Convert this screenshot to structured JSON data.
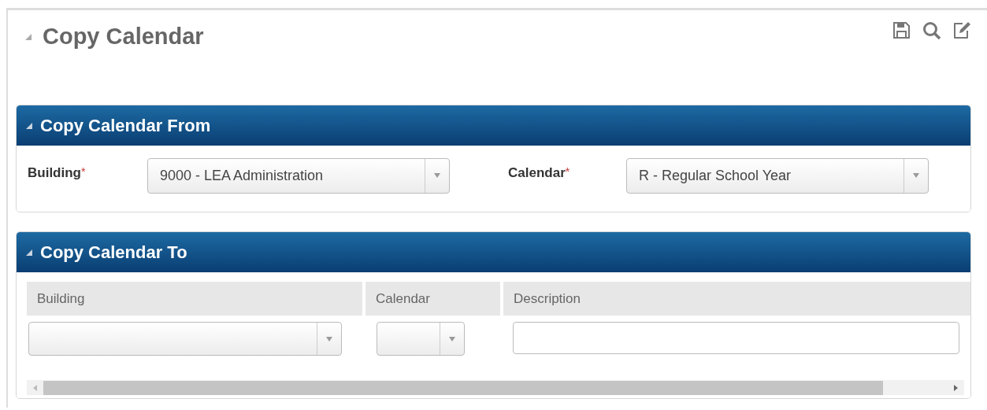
{
  "page": {
    "title": "Copy Calendar",
    "expanded": true
  },
  "toolbar": [
    {
      "kind": "save"
    },
    {
      "kind": "search"
    },
    {
      "kind": "edit"
    }
  ],
  "from_section": {
    "title": "Copy Calendar From",
    "expanded": true,
    "fields": [
      {
        "label": "Building",
        "required_mark": "*",
        "value": "9000 - LEA Administration"
      },
      {
        "label": "Calendar",
        "required_mark": "*",
        "value": "R - Regular School Year"
      }
    ]
  },
  "to_section": {
    "title": "Copy Calendar To",
    "expanded": true,
    "table": {
      "columns": [
        {
          "label": "Building",
          "kind": "select"
        },
        {
          "label": "Calendar",
          "kind": "select"
        },
        {
          "label": "Description",
          "kind": "text"
        }
      ]
    }
  }
}
